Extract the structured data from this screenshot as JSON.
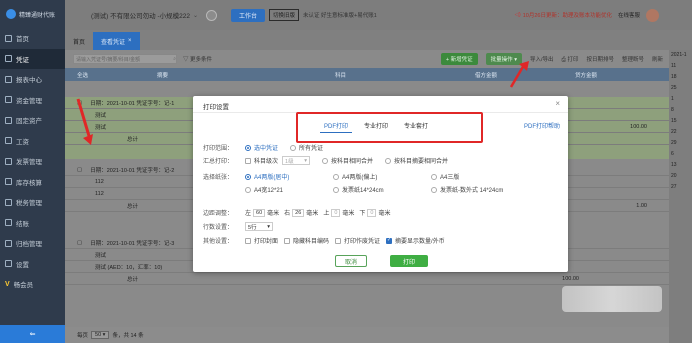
{
  "logo": {
    "text": "精臻通财代账"
  },
  "sidebar": {
    "items": [
      {
        "label": "首页",
        "icon": "home-icon"
      },
      {
        "label": "凭证",
        "icon": "voucher-icon"
      },
      {
        "label": "报表中心",
        "icon": "report-icon"
      },
      {
        "label": "资金管理",
        "icon": "wallet-icon"
      },
      {
        "label": "固定资产",
        "icon": "asset-icon"
      },
      {
        "label": "工资",
        "icon": "salary-icon"
      },
      {
        "label": "发票管理",
        "icon": "invoice-icon"
      },
      {
        "label": "库存核算",
        "icon": "stock-icon"
      },
      {
        "label": "税务管理",
        "icon": "tax-icon"
      },
      {
        "label": "结账",
        "icon": "close-books-icon"
      },
      {
        "label": "归档管理",
        "icon": "archive-icon"
      },
      {
        "label": "设置",
        "icon": "settings-icon"
      },
      {
        "label": "畅会员",
        "icon": "vip-icon"
      }
    ],
    "collapse_glyph": "⇐"
  },
  "topbar": {
    "company": "(测试) 不有限公司勿动 -小规模222",
    "workbench_label": "工作台",
    "switch_label": "切换旧版",
    "cert_text": "未认证 好生意标准版+易代账1",
    "notice_text": "10月26日更新：助理及账本功能优化",
    "service_text": "在线客服"
  },
  "tabs": [
    {
      "label": "首页"
    },
    {
      "label": "查看凭证"
    }
  ],
  "toolbar": {
    "search_placeholder": "请输入凭证号/摘要/科目/金额",
    "more_conditions": "更多条件",
    "new_voucher": "新增凭证",
    "batch_ops": "批量操作",
    "import_export": "导入/导出",
    "print": "打印",
    "sort_number": "按日期排号",
    "renumber": "整理断号",
    "refresh": "刷新"
  },
  "table": {
    "headers": [
      "全选",
      "摘要",
      "科目",
      "借方金额",
      "贷方金额"
    ],
    "vouchers": [
      {
        "header": "日期：2021-10-01  凭证字号：记-1",
        "lines": [
          "测试",
          "测试"
        ],
        "amount": "100.00",
        "total_label": "总计"
      },
      {
        "header": "日期：2021-10-01  凭证字号：记-2",
        "lines": [
          "112",
          "112"
        ],
        "amount": "1.00",
        "total_label": "总计"
      },
      {
        "header": "日期：2021-10-01  凭证字号：记-3",
        "lines": [
          "测试",
          "测试 (AED：10，汇率：10)"
        ],
        "amount": "100.00",
        "total_label": "总计"
      }
    ]
  },
  "pager": {
    "prefix": "每页",
    "size": "50",
    "suffix": "条，共 14 条"
  },
  "right_panel": {
    "items": [
      "2021-1",
      "11",
      "18",
      "25",
      "1",
      "8",
      "15",
      "22",
      "29",
      "6",
      "13",
      "20",
      "27"
    ]
  },
  "dialog": {
    "title": "打印设置",
    "close": "×",
    "tabs": [
      "PDF打印",
      "专业打印",
      "专业套打"
    ],
    "help": "PDF打印帮助",
    "range": {
      "label": "打印范围：",
      "options": [
        "选中凭证",
        "所有凭证"
      ]
    },
    "summary": {
      "label": "汇总打印：",
      "options": [
        "科目级次",
        "按科目相同合并",
        "按科目摘要相同合并"
      ],
      "level": "1级"
    },
    "paper": {
      "label": "选择纸张：",
      "options": [
        "A4两版(居中)",
        "A4两版(偏上)",
        "A4三版",
        "A4宽12*21",
        "发票纸14*24cm",
        "发票纸-数外式 14*24cm"
      ]
    },
    "margins": {
      "label": "边距调整：",
      "left_label": "左",
      "left": "60",
      "right_label": "右",
      "right": "26",
      "top_label": "上",
      "top": "0",
      "bottom_label": "下",
      "bottom": "0",
      "unit": "毫米"
    },
    "rows": {
      "label": "行数设置：",
      "value": "5行"
    },
    "others": {
      "label": "其他设置：",
      "options": [
        "打印封面",
        "隐藏科目编码",
        "打印作废凭证",
        "摘要显示数量/外币"
      ]
    },
    "cancel_label": "取消",
    "print_label": "打印"
  },
  "colors": {
    "accent": "#2d6fc0",
    "highlight": "#e02727",
    "print_button": "#3fae43"
  }
}
